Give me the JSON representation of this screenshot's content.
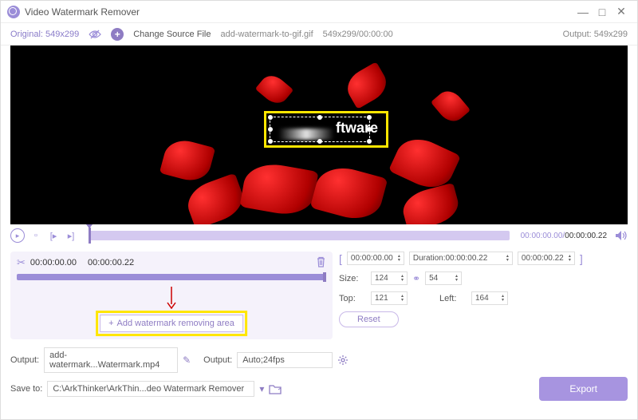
{
  "app": {
    "title": "Video Watermark Remover"
  },
  "toolbar": {
    "original_label": "Original: 549x299",
    "change_source": "Change Source File",
    "filename": "add-watermark-to-gif.gif",
    "dims_time": "549x299/00:00:00",
    "output_label": "Output: 549x299"
  },
  "watermark": {
    "text_visible": "ftware"
  },
  "player": {
    "time_current": "00:00:00.00",
    "time_total": "00:00:00.22"
  },
  "segment": {
    "start": "00:00:00.00",
    "end": "00:00:00.22",
    "bracket_start": "00:00:00.00",
    "duration_label": "Duration:00:00:00.22",
    "bracket_end": "00:00:00.22"
  },
  "size": {
    "label": "Size:",
    "w": "124",
    "h": "54"
  },
  "pos": {
    "top_label": "Top:",
    "top": "121",
    "left_label": "Left:",
    "left": "164"
  },
  "buttons": {
    "reset": "Reset",
    "add_area": "Add watermark removing area",
    "export": "Export"
  },
  "output": {
    "label1": "Output:",
    "filename": "add-watermark...Watermark.mp4",
    "label2": "Output:",
    "format": "Auto;24fps"
  },
  "save": {
    "label": "Save to:",
    "path": "C:\\ArkThinker\\ArkThin...deo Watermark Remover"
  }
}
